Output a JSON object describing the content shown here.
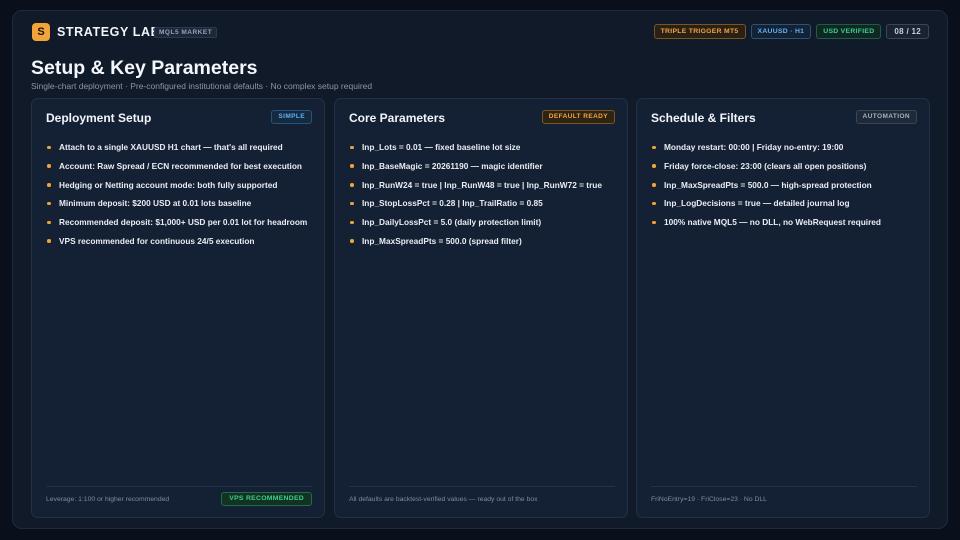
{
  "header": {
    "logo_letter": "S",
    "brand": "STRATEGY LAB.",
    "brand_tag": "MQL5 MARKET",
    "badges": [
      "TRIPLE TRIGGER MT5",
      "XAUUSD · H1",
      "USD VERIFIED"
    ],
    "page": "08 / 12"
  },
  "page": {
    "title": "Setup & Key Parameters",
    "subtitle": "Single-chart deployment  ·  Pre-configured institutional defaults  ·  No complex setup required"
  },
  "panels": [
    {
      "title": "Deployment Setup",
      "tag": "SIMPLE",
      "items": [
        "Attach to a single XAUUSD H1 chart — that's all required",
        "Account: Raw Spread / ECN recommended for best execution",
        "Hedging or Netting account mode: both fully supported",
        "Minimum deposit: $200 USD at 0.01 lots baseline",
        "Recommended deposit: $1,000+ USD per 0.01 lot for headroom",
        "VPS recommended for continuous 24/5 execution"
      ],
      "footer": "Leverage: 1:100 or higher recommended",
      "footer_badge": "VPS RECOMMENDED"
    },
    {
      "title": "Core Parameters",
      "tag": "DEFAULT READY",
      "items": [
        "Inp_Lots = 0.01 — fixed baseline lot size",
        "Inp_BaseMagic = 20261190 — magic identifier",
        "Inp_RunW24 = true  |  Inp_RunW48 = true  |  Inp_RunW72 = true",
        "Inp_StopLossPct = 0.28  |  Inp_TrailRatio = 0.85",
        "Inp_DailyLossPct = 5.0 (daily protection limit)",
        "Inp_MaxSpreadPts = 500.0 (spread filter)"
      ],
      "footer": "All defaults are backtest-verified values — ready out of the box"
    },
    {
      "title": "Schedule & Filters",
      "tag": "AUTOMATION",
      "items": [
        "Monday restart: 00:00  |  Friday no-entry: 19:00",
        "Friday force-close: 23:00 (clears all open positions)",
        "Inp_MaxSpreadPts = 500.0 — high-spread protection",
        "Inp_LogDecisions = true — detailed journal log",
        "100% native MQL5 — no DLL, no WebRequest required"
      ],
      "footer": "FriNoEntry=19  ·  FriClose=23  ·  No DLL"
    }
  ]
}
